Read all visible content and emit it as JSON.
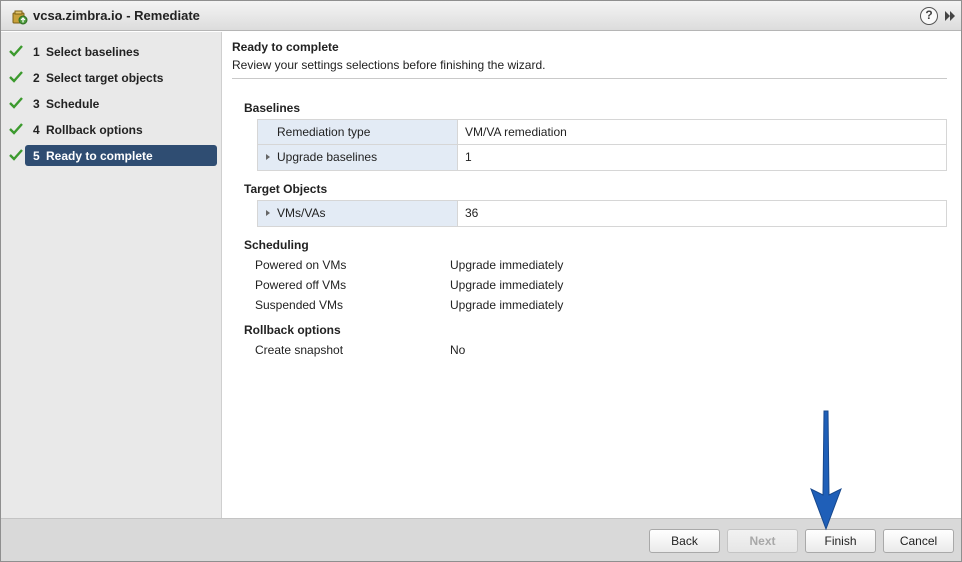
{
  "window": {
    "title": "vcsa.zimbra.io - Remediate",
    "help_label": "?"
  },
  "steps": [
    {
      "num": "1",
      "label": "Select baselines",
      "completed": true,
      "active": false
    },
    {
      "num": "2",
      "label": "Select target objects",
      "completed": true,
      "active": false
    },
    {
      "num": "3",
      "label": "Schedule",
      "completed": true,
      "active": false
    },
    {
      "num": "4",
      "label": "Rollback options",
      "completed": true,
      "active": false
    },
    {
      "num": "5",
      "label": "Ready to complete",
      "completed": true,
      "active": true
    }
  ],
  "main": {
    "title": "Ready to complete",
    "subtitle": "Review your settings selections before finishing the wizard."
  },
  "baselines": {
    "heading": "Baselines",
    "rows": [
      {
        "key": "Remediation type",
        "value": "VM/VA remediation",
        "expandable": false
      },
      {
        "key": "Upgrade baselines",
        "value": "1",
        "expandable": true
      }
    ]
  },
  "target_objects": {
    "heading": "Target Objects",
    "rows": [
      {
        "key": "VMs/VAs",
        "value": "36",
        "expandable": true
      }
    ]
  },
  "scheduling": {
    "heading": "Scheduling",
    "rows": [
      {
        "key": "Powered on VMs",
        "value": "Upgrade immediately"
      },
      {
        "key": "Powered off VMs",
        "value": "Upgrade immediately"
      },
      {
        "key": "Suspended VMs",
        "value": "Upgrade immediately"
      }
    ]
  },
  "rollback": {
    "heading": "Rollback options",
    "rows": [
      {
        "key": "Create snapshot",
        "value": "No"
      }
    ]
  },
  "footer": {
    "back_label": "Back",
    "next_label": "Next",
    "finish_label": "Finish",
    "cancel_label": "Cancel"
  },
  "colors": {
    "active_step_bg": "#2f4d72",
    "check_green": "#3c9a2e",
    "key_cell_bg": "#e3ebf5",
    "annotation_arrow": "#1f5fb8"
  }
}
